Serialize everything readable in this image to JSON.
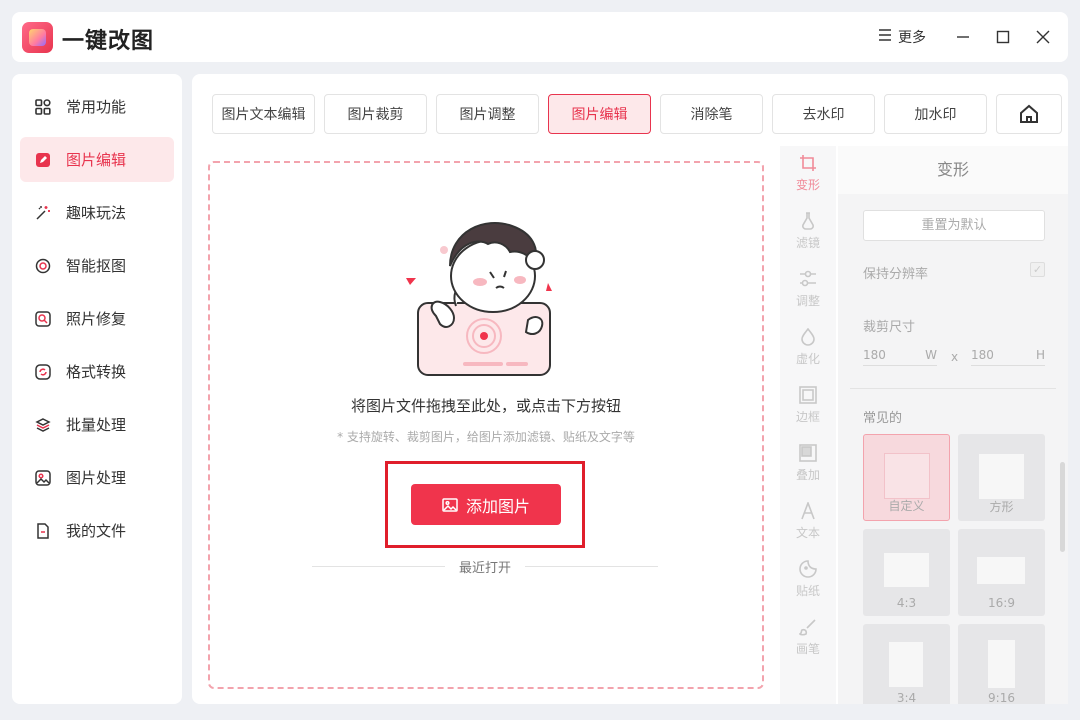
{
  "app": {
    "title": "一键改图"
  },
  "titlebar": {
    "more_label": "更多"
  },
  "sidebar": {
    "items": [
      {
        "label": "常用功能",
        "icon": "grid-icon"
      },
      {
        "label": "图片编辑",
        "icon": "edit-icon",
        "active": true
      },
      {
        "label": "趣味玩法",
        "icon": "magic-wand-icon"
      },
      {
        "label": "智能抠图",
        "icon": "target-icon"
      },
      {
        "label": "照片修复",
        "icon": "photo-repair-icon"
      },
      {
        "label": "格式转换",
        "icon": "convert-icon"
      },
      {
        "label": "批量处理",
        "icon": "layers-icon"
      },
      {
        "label": "图片处理",
        "icon": "image-icon"
      },
      {
        "label": "我的文件",
        "icon": "file-icon"
      }
    ]
  },
  "tabs": [
    "图片文本编辑",
    "图片裁剪",
    "图片调整",
    "图片编辑",
    "消除笔",
    "去水印",
    "加水印"
  ],
  "active_tab": "图片编辑",
  "dropzone": {
    "text": "将图片文件拖拽至此处，或点击下方按钮",
    "hint": "* 支持旋转、裁剪图片，给图片添加滤镜、贴纸及文字等",
    "button_label": "添加图片",
    "recent_label": "最近打开"
  },
  "tools": [
    {
      "label": "变形",
      "icon": "crop-icon",
      "active": true
    },
    {
      "label": "滤镜",
      "icon": "flask-icon"
    },
    {
      "label": "调整",
      "icon": "sliders-icon"
    },
    {
      "label": "虚化",
      "icon": "drop-icon"
    },
    {
      "label": "边框",
      "icon": "frame-icon"
    },
    {
      "label": "叠加",
      "icon": "overlay-icon"
    },
    {
      "label": "文本",
      "icon": "text-icon"
    },
    {
      "label": "贴纸",
      "icon": "sticker-icon"
    },
    {
      "label": "画笔",
      "icon": "brush-icon"
    }
  ],
  "panel": {
    "title": "变形",
    "reset_label": "重置为默认",
    "keep_resolution_label": "保持分辨率",
    "crop_size_label": "裁剪尺寸",
    "width_value": "180",
    "width_unit": "W",
    "x_label": "x",
    "height_value": "180",
    "height_unit": "H",
    "common_label": "常见的",
    "presets": [
      "自定义",
      "方形",
      "4:3",
      "16:9",
      "3:4",
      "9:16"
    ]
  },
  "colors": {
    "accent": "#f0344c",
    "accent_light": "#fde8ea",
    "highlight_frame": "#e01e2b"
  }
}
